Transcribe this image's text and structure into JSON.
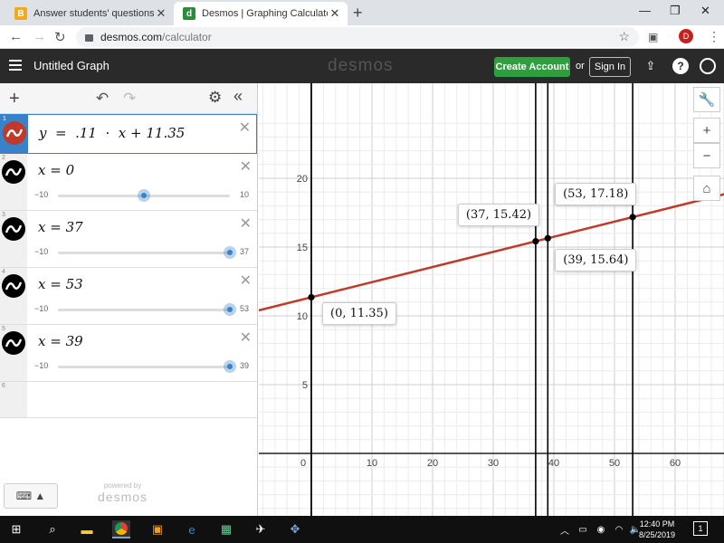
{
  "browser": {
    "tabs": [
      {
        "title": "Answer students' questions and",
        "active": false,
        "icon": "brainly-icon"
      },
      {
        "title": "Desmos | Graphing Calculator",
        "active": true,
        "icon": "desmos-icon"
      }
    ],
    "url_host": "desmos.com",
    "url_path": "/calculator",
    "profile_initial": "D"
  },
  "header": {
    "title": "Untitled Graph",
    "logo": "desmos",
    "create_account": "Create Account",
    "or": "or",
    "sign_in": "Sign In"
  },
  "expressions": [
    {
      "index": "1",
      "formula": "y  =  .11  ·  x + 11.35",
      "color": "#c0392b"
    },
    {
      "index": "2",
      "formula": "x = 0",
      "slider": {
        "min": "−10",
        "max": "10",
        "value": 0,
        "lo": -10,
        "hi": 10
      }
    },
    {
      "index": "3",
      "formula": "x = 37",
      "slider": {
        "min": "−10",
        "max": "37",
        "value": 37,
        "lo": -10,
        "hi": 37
      }
    },
    {
      "index": "4",
      "formula": "x = 53",
      "slider": {
        "min": "−10",
        "max": "53",
        "value": 53,
        "lo": -10,
        "hi": 53
      }
    },
    {
      "index": "5",
      "formula": "x = 39",
      "slider": {
        "min": "−10",
        "max": "39",
        "value": 39,
        "lo": -10,
        "hi": 39
      }
    },
    {
      "index": "6",
      "formula": ""
    }
  ],
  "powered_by": {
    "line1": "powered by",
    "line2": "desmos"
  },
  "graph": {
    "x_ticks": [
      "0",
      "10",
      "20",
      "30",
      "40",
      "50",
      "60"
    ],
    "y_ticks": [
      "5",
      "10",
      "15",
      "20"
    ],
    "line": {
      "slope": 0.11,
      "intercept": 11.35,
      "color": "#c0392b"
    },
    "vertical_lines": [
      0,
      37,
      39,
      53
    ],
    "points": [
      {
        "x": 0,
        "y": 11.35,
        "label": "(0, 11.35)"
      },
      {
        "x": 37,
        "y": 15.42,
        "label": "(37, 15.42)"
      },
      {
        "x": 39,
        "y": 15.64,
        "label": "(39, 15.64)"
      },
      {
        "x": 53,
        "y": 17.18,
        "label": "(53, 17.18)"
      }
    ]
  },
  "taskbar": {
    "time": "12:40 PM",
    "date": "8/25/2019",
    "notifications": "1"
  }
}
